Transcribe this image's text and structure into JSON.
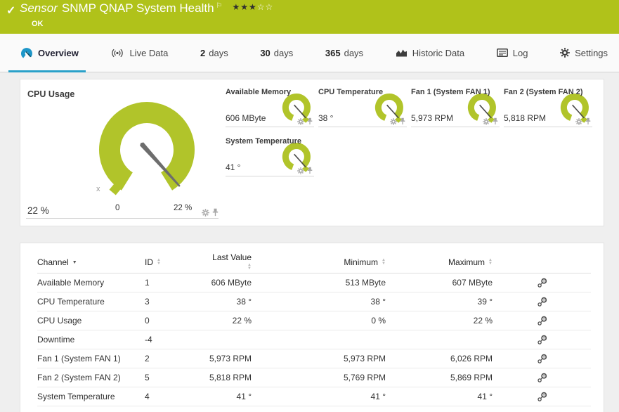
{
  "header": {
    "type_label": "Sensor",
    "title": "SNMP QNAP System Health",
    "status_text": "OK",
    "check_glyph": "✓",
    "flag_glyph": "⚐",
    "stars_filled": "★★★",
    "stars_empty": "☆☆"
  },
  "tabs": [
    {
      "label": "Overview",
      "active": true
    },
    {
      "label": "Live Data"
    },
    {
      "num": "2",
      "label": "days"
    },
    {
      "num": "30",
      "label": "days"
    },
    {
      "num": "365",
      "label": "days"
    },
    {
      "label": "Historic Data"
    },
    {
      "label": "Log"
    },
    {
      "label": "Settings"
    }
  ],
  "overview_panel": {
    "primary_gauge": {
      "title": "CPU Usage",
      "value": "22 %",
      "scale_min": "0",
      "scale_max": "22 %",
      "marker": "x"
    },
    "mini_gauges": [
      {
        "title": "Available Memory",
        "value": "606 MByte"
      },
      {
        "title": "CPU Temperature",
        "value": "38 °"
      },
      {
        "title": "Fan 1 (System FAN 1)",
        "value": "5,973 RPM"
      },
      {
        "title": "Fan 2 (System FAN 2)",
        "value": "5,818 RPM"
      },
      {
        "title": "System Temperature",
        "value": "41 °"
      }
    ]
  },
  "channel_table": {
    "columns": {
      "channel": "Channel",
      "id": "ID",
      "last": "Last Value",
      "min": "Minimum",
      "max": "Maximum"
    },
    "rows": [
      {
        "channel": "Available Memory",
        "id": "1",
        "last": "606 MByte",
        "min": "513 MByte",
        "max": "607 MByte"
      },
      {
        "channel": "CPU Temperature",
        "id": "3",
        "last": "38 °",
        "min": "38 °",
        "max": "39 °"
      },
      {
        "channel": "CPU Usage",
        "id": "0",
        "last": "22 %",
        "min": "0 %",
        "max": "22 %"
      },
      {
        "channel": "Downtime",
        "id": "-4",
        "last": "",
        "min": "",
        "max": ""
      },
      {
        "channel": "Fan 1 (System FAN 1)",
        "id": "2",
        "last": "5,973 RPM",
        "min": "5,973 RPM",
        "max": "6,026 RPM"
      },
      {
        "channel": "Fan 2 (System FAN 2)",
        "id": "5",
        "last": "5,818 RPM",
        "min": "5,769 RPM",
        "max": "5,869 RPM"
      },
      {
        "channel": "System Temperature",
        "id": "4",
        "last": "41 °",
        "min": "41 °",
        "max": "41 °"
      }
    ]
  },
  "colors": {
    "status_green": "#b0c21a",
    "gauge_green": "#b1c42a",
    "accent_blue": "#2aa1c9",
    "needle_gray": "#6d6d6d"
  }
}
